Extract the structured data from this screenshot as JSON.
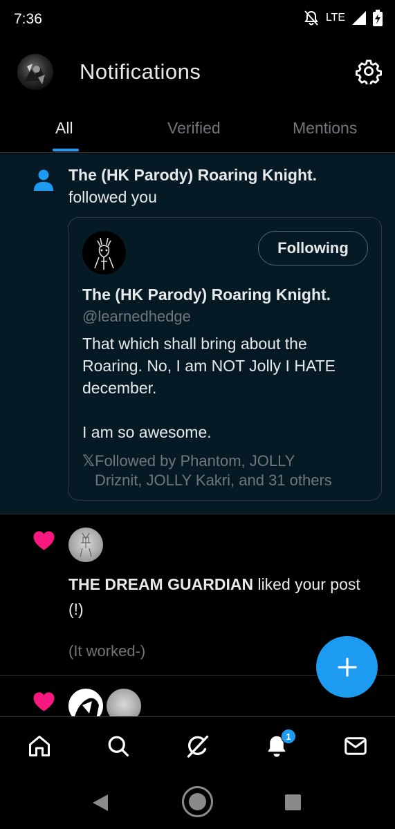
{
  "status_bar": {
    "time": "7:36",
    "network": "LTE",
    "icons": [
      "notifications-off-icon",
      "signal-icon",
      "battery-charging-icon"
    ]
  },
  "header": {
    "title": "Notifications",
    "settings_icon": "gear-icon"
  },
  "tabs": [
    {
      "label": "All",
      "active": true
    },
    {
      "label": "Verified",
      "active": false
    },
    {
      "label": "Mentions",
      "active": false
    }
  ],
  "notifications": {
    "follow": {
      "icon": "person-icon",
      "name": "The (HK Parody) Roaring Knight.",
      "action": "followed you",
      "card": {
        "name": "The (HK Parody) Roaring Knight.",
        "handle": "@learnedhedge",
        "button": "Following",
        "bio": "That which shall bring about the Roaring. No, I am NOT Jolly I HATE december.\n\nI am so awesome.",
        "followed_by_prefix": "𝕏",
        "followed_by_line1": "Followed by Phantom, JOLLY",
        "followed_by_line2": "Driznit, JOLLY Kakri, and 31 others"
      }
    },
    "like": {
      "icon": "heart-icon",
      "user": "THE DREAM GUARDIAN",
      "action": " liked your post",
      "post_line1": "(!)",
      "post_line2": "(It worked-)"
    }
  },
  "fab": {
    "icon": "plus-icon"
  },
  "bottom_nav": {
    "items": [
      "home-icon",
      "search-icon",
      "grok-icon",
      "notifications-icon",
      "messages-icon"
    ],
    "notifications_badge": "1"
  },
  "colors": {
    "accent": "#1d9bf0",
    "like": "#f91880",
    "highlight_bg": "#061a26",
    "secondary_text": "#71767b"
  }
}
